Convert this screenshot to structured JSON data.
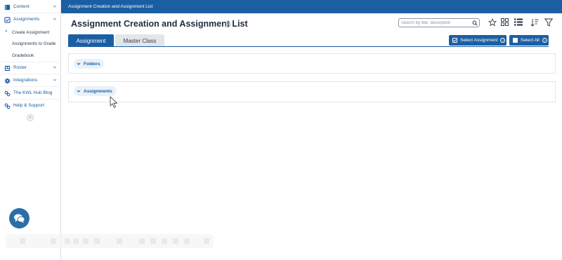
{
  "topbar": {
    "breadcrumb": "Assignment Creation and Assignment List"
  },
  "sidebar": {
    "items": [
      {
        "label": "Content",
        "icon": "book-icon"
      },
      {
        "label": "Assignments",
        "icon": "assignment-check-icon"
      },
      {
        "label": "Roster",
        "icon": "roster-icon"
      },
      {
        "label": "Integrations",
        "icon": "gear-icon"
      },
      {
        "label": "The KWL Hub Blog",
        "icon": "link-icon"
      },
      {
        "label": "Help & Support",
        "icon": "link-icon"
      }
    ],
    "assignments_sub": [
      {
        "label": "Create Assignment",
        "active": true
      },
      {
        "label": "Assignments to Grade",
        "active": false
      },
      {
        "label": "Gradebook",
        "active": false
      }
    ],
    "collapse_glyph": "«"
  },
  "header": {
    "title": "Assignment Creation and Assignment List",
    "help_glyph": "?"
  },
  "search": {
    "placeholder": "Search by title, description",
    "value": ""
  },
  "tabs": [
    {
      "label": "Assignment",
      "active": true
    },
    {
      "label": "Master Class",
      "active": false
    }
  ],
  "actions": {
    "select_assignment": "Select Assignment",
    "select_all": "Select All",
    "info_glyph": "i"
  },
  "panels": {
    "folders": "Folders",
    "assignments": "Assignments"
  },
  "colors": {
    "brand": "#1b5fa3",
    "tab_inactive": "#e3e6e9",
    "chat": "#2b6fa8"
  }
}
